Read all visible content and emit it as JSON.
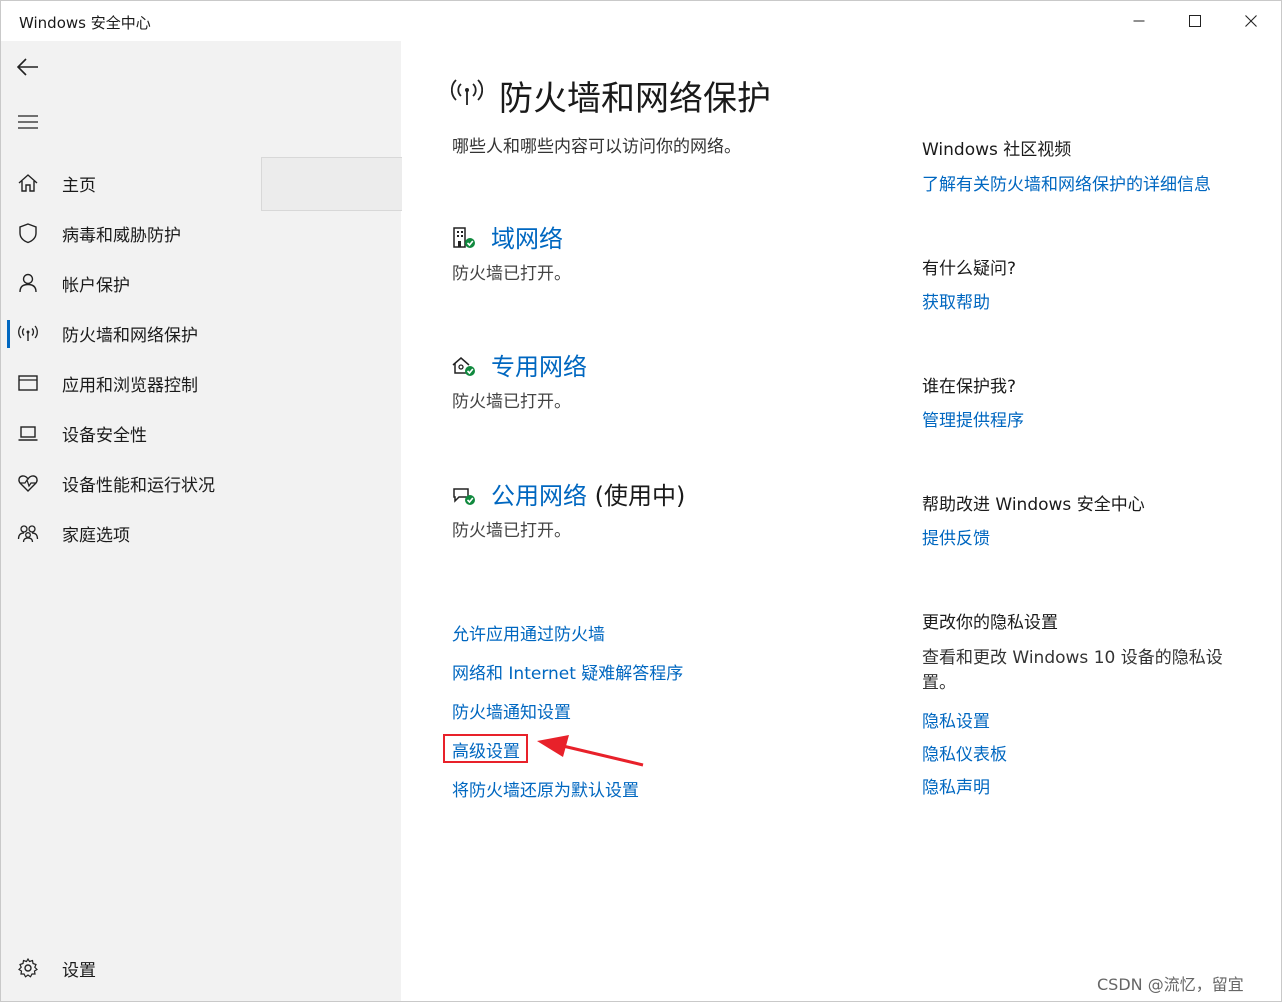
{
  "window": {
    "title": "Windows 安全中心"
  },
  "sidebar": {
    "items": [
      {
        "label": "主页",
        "icon": "home-icon"
      },
      {
        "label": "病毒和威胁防护",
        "icon": "shield-icon"
      },
      {
        "label": "帐户保护",
        "icon": "person-icon"
      },
      {
        "label": "防火墙和网络保护",
        "icon": "antenna-icon",
        "selected": true
      },
      {
        "label": "应用和浏览器控制",
        "icon": "browser-window-icon"
      },
      {
        "label": "设备安全性",
        "icon": "laptop-icon"
      },
      {
        "label": "设备性能和运行状况",
        "icon": "heart-pulse-icon"
      },
      {
        "label": "家庭选项",
        "icon": "family-icon"
      }
    ],
    "settings_label": "设置"
  },
  "main": {
    "title": "防火墙和网络保护",
    "subtitle": "哪些人和哪些内容可以访问你的网络。",
    "networks": [
      {
        "name": "域网络",
        "in_use": "",
        "status": "防火墙已打开。",
        "icon": "domain-network-icon"
      },
      {
        "name": "专用网络",
        "in_use": "",
        "status": "防火墙已打开。",
        "icon": "private-network-icon"
      },
      {
        "name": "公用网络",
        "in_use": " (使用中)",
        "status": "防火墙已打开。",
        "icon": "public-network-icon"
      }
    ],
    "links": [
      "允许应用通过防火墙",
      "网络和 Internet 疑难解答程序",
      "防火墙通知设置",
      "高级设置",
      "将防火墙还原为默认设置"
    ]
  },
  "right": {
    "community_title": "Windows 社区视频",
    "community_link": "了解有关防火墙和网络保护的详细信息",
    "question_title": "有什么疑问?",
    "help_link": "获取帮助",
    "protect_title": "谁在保护我?",
    "provider_link": "管理提供程序",
    "improve_title": "帮助改进 Windows 安全中心",
    "feedback_link": "提供反馈",
    "privacy_title": "更改你的隐私设置",
    "privacy_text": "查看和更改 Windows 10 设备的隐私设置。",
    "privacy_links": [
      "隐私设置",
      "隐私仪表板",
      "隐私声明"
    ]
  },
  "watermark": "CSDN @流忆，留宜",
  "colors": {
    "accent": "#0067c0",
    "sidebar_bg": "#f2f2f2",
    "annotation_red": "#e8212a",
    "status_green": "#10893e"
  }
}
